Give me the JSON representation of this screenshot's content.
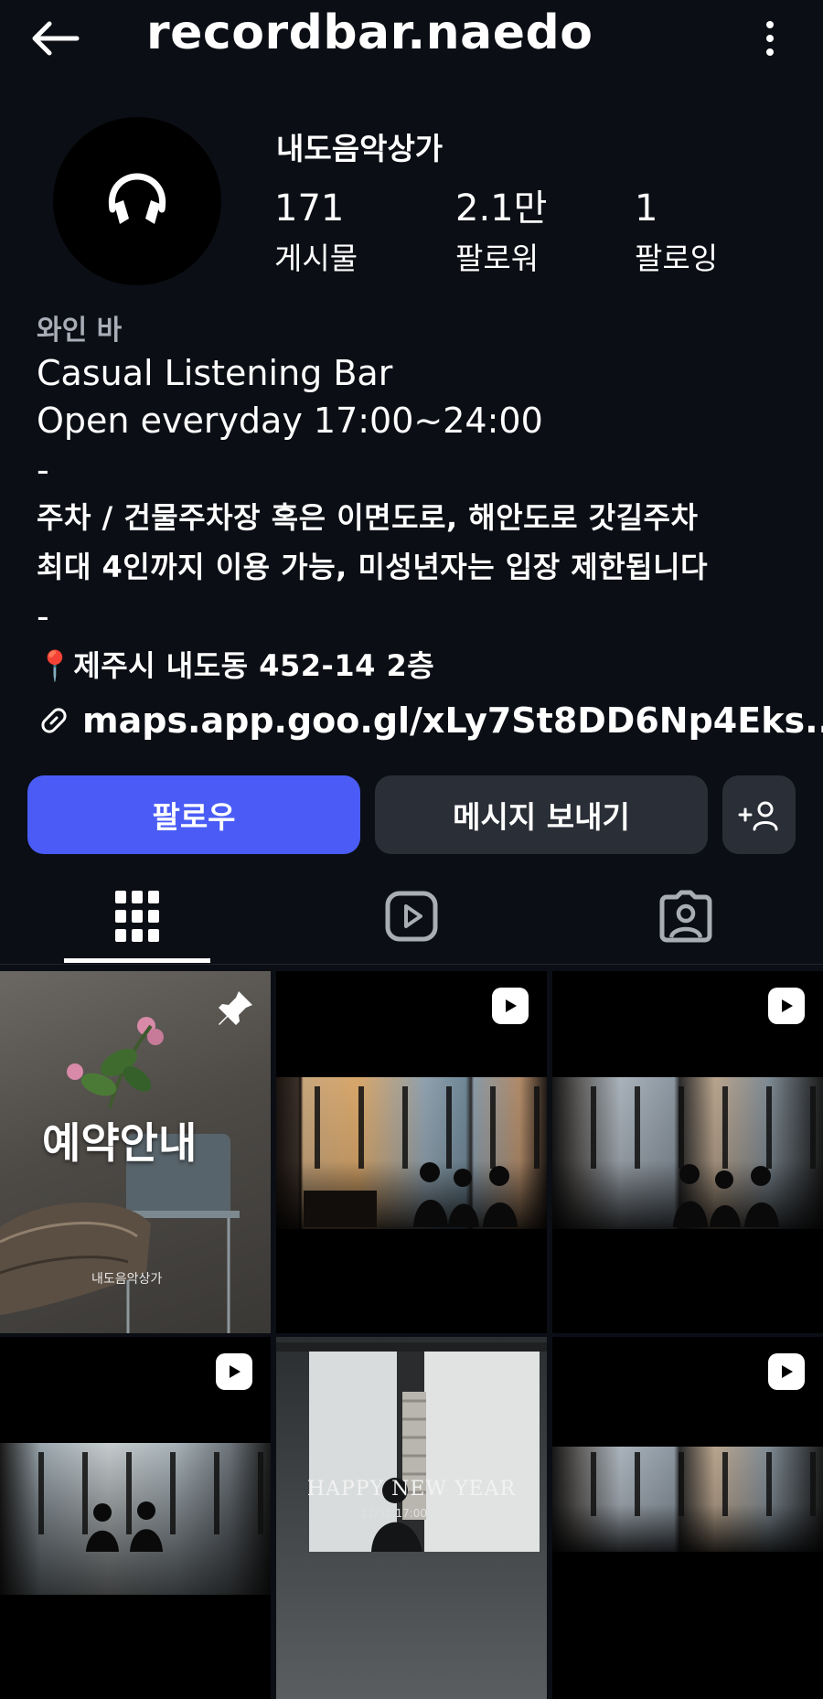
{
  "header": {
    "username": "recordbar.naedo"
  },
  "profile": {
    "display_name": "내도음악상가",
    "stats": [
      {
        "value": "171",
        "label": "게시물"
      },
      {
        "value": "2.1만",
        "label": "팔로워"
      },
      {
        "value": "1",
        "label": "팔로잉"
      }
    ],
    "category": "와인 바",
    "bio_lines": [
      "Casual Listening Bar",
      "Open everyday 17:00~24:00",
      "-",
      "주차 / 건물주차장 혹은 이면도로, 해안도로 갓길주차",
      "최대 4인까지 이용 가능, 미성년자는 입장 제한됩니다",
      "-",
      "📍제주시 내도동 452-14 2층"
    ],
    "link": "maps.app.goo.gl/xLy7St8DD6Np4Eks..."
  },
  "actions": {
    "follow": "팔로우",
    "message": "메시지 보내기"
  },
  "grid": {
    "tile1_text": "예약안내",
    "tile1_sub": "내도음악상가",
    "tile5_title": "HAPPY NEW YEAR",
    "tile5_sub": "12/31 17:00-01:00"
  },
  "colors": {
    "background": "#0b0e14",
    "follow_button": "#4a5cf5",
    "secondary_button": "#2a2e36"
  }
}
